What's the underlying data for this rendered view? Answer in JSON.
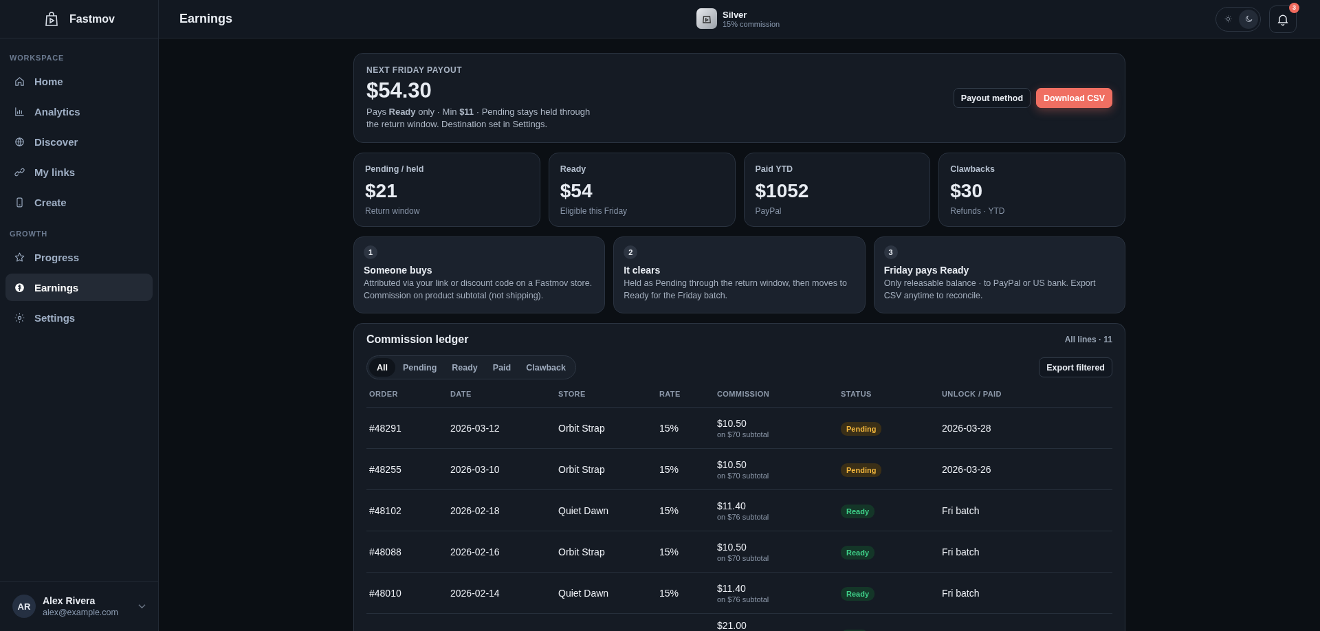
{
  "brand": {
    "name": "Fastmov"
  },
  "sidebar": {
    "sections": [
      {
        "title": "WORKSPACE",
        "items": [
          {
            "label": "Home",
            "selected": false
          },
          {
            "label": "Analytics",
            "selected": false
          },
          {
            "label": "Discover",
            "selected": false
          },
          {
            "label": "My links",
            "selected": false
          },
          {
            "label": "Create",
            "selected": false
          }
        ]
      },
      {
        "title": "GROWTH",
        "items": [
          {
            "label": "Progress",
            "selected": false
          },
          {
            "label": "Earnings",
            "selected": true
          },
          {
            "label": "Settings",
            "selected": false
          }
        ]
      }
    ]
  },
  "user": {
    "initials": "AR",
    "name": "Alex Rivera",
    "email": "alex@example.com"
  },
  "header": {
    "title": "Earnings",
    "tier": "Silver",
    "tier_note": "15% commission",
    "dark_mode": true,
    "notifications": "3"
  },
  "payout": {
    "label": "NEXT FRIDAY PAYOUT",
    "amount": "$54.30",
    "note": "Pays **Ready** only · Min **$11** · Pending stays held through the return window. Destination set in Settings.",
    "buttons": [
      "Payout method",
      "Download CSV"
    ]
  },
  "stats": [
    {
      "label": "Pending / held",
      "value": "$21",
      "note": "Return window"
    },
    {
      "label": "Ready",
      "value": "$54",
      "note": "Eligible this Friday"
    },
    {
      "label": "Paid YTD",
      "value": "$1052",
      "note": "PayPal"
    },
    {
      "label": "Clawbacks",
      "value": "$30",
      "note": "Refunds · YTD"
    }
  ],
  "steps": [
    {
      "number": "1",
      "title": "Someone buys",
      "text": "Attributed via your link or discount code on a Fastmov store. Commission on product subtotal (not shipping)."
    },
    {
      "number": "2",
      "title": "It clears",
      "text": "Held as Pending through the return window, then moves to Ready for the Friday batch."
    },
    {
      "number": "3",
      "title": "Friday pays Ready",
      "text": "Only releasable balance · to PayPal or US bank. Export CSV anytime to reconcile."
    }
  ],
  "ledger": {
    "title": "Commission ledger",
    "count": "All lines · 11",
    "filters": [
      {
        "label": "All",
        "selected": true
      },
      {
        "label": "Pending",
        "selected": false
      },
      {
        "label": "Ready",
        "selected": false
      },
      {
        "label": "Paid",
        "selected": false
      },
      {
        "label": "Clawback",
        "selected": false
      }
    ],
    "export_button": "Export filtered",
    "columns": [
      "ORDER",
      "DATE",
      "STORE",
      "RATE",
      "COMMISSION",
      "STATUS",
      "UNLOCK / PAID"
    ],
    "rows": [
      {
        "order": "#48291",
        "date": "2026-03-12",
        "store": "Orbit Strap",
        "rate": "15%",
        "commission": "$10.50",
        "subtotal": "on $70 subtotal",
        "status": "Pending",
        "kind": "pending",
        "unlock": "2026-03-28"
      },
      {
        "order": "#48255",
        "date": "2026-03-10",
        "store": "Orbit Strap",
        "rate": "15%",
        "commission": "$10.50",
        "subtotal": "on $70 subtotal",
        "status": "Pending",
        "kind": "pending",
        "unlock": "2026-03-26"
      },
      {
        "order": "#48102",
        "date": "2026-02-18",
        "store": "Quiet Dawn",
        "rate": "15%",
        "commission": "$11.40",
        "subtotal": "on $76 subtotal",
        "status": "Ready",
        "kind": "ready",
        "unlock": "Fri batch"
      },
      {
        "order": "#48088",
        "date": "2026-02-16",
        "store": "Orbit Strap",
        "rate": "15%",
        "commission": "$10.50",
        "subtotal": "on $70 subtotal",
        "status": "Ready",
        "kind": "ready",
        "unlock": "Fri batch"
      },
      {
        "order": "#48010",
        "date": "2026-02-14",
        "store": "Quiet Dawn",
        "rate": "15%",
        "commission": "$11.40",
        "subtotal": "on $76 subtotal",
        "status": "Ready",
        "kind": "ready",
        "unlock": "Fri batch"
      },
      {
        "commission": "$21.00",
        "kind": "ready"
      }
    ]
  }
}
